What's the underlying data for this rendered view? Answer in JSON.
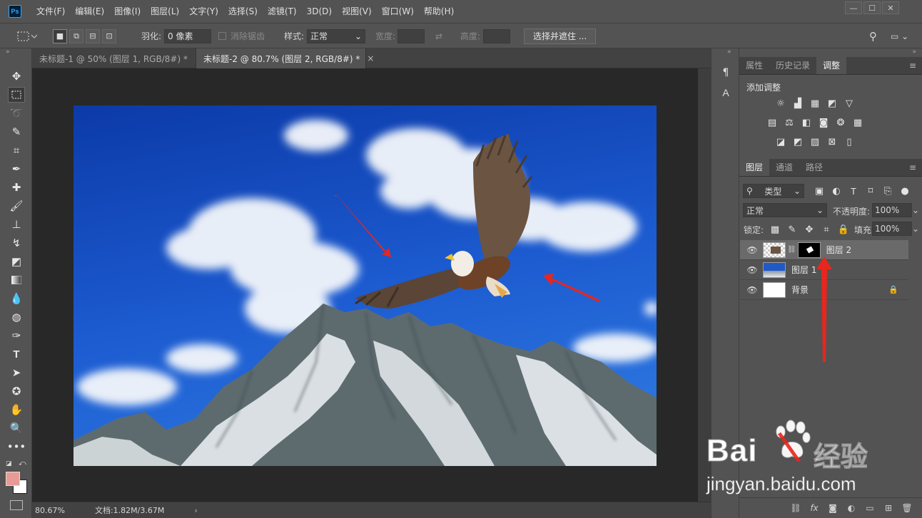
{
  "app": {
    "logo_text": "Ps"
  },
  "menubar": {
    "items": [
      "文件(F)",
      "编辑(E)",
      "图像(I)",
      "图层(L)",
      "文字(Y)",
      "选择(S)",
      "滤镜(T)",
      "3D(D)",
      "视图(V)",
      "窗口(W)",
      "帮助(H)"
    ],
    "window_controls": [
      "minimize",
      "restore",
      "close"
    ]
  },
  "options": {
    "feather_label": "羽化:",
    "feather_value": "0 像素",
    "antialias_label": "消除锯齿",
    "style_label": "样式:",
    "style_value": "正常",
    "width_label": "宽度:",
    "height_label": "高度:",
    "select_mask_button": "选择并遮住 ..."
  },
  "tabs": [
    {
      "label": "未标题-1 @ 50% (图层 1, RGB/8#) *",
      "active": false
    },
    {
      "label": "未标题-2 @ 80.7% (图层 2, RGB/8#) *",
      "active": true
    }
  ],
  "status": {
    "zoom": "80.67%",
    "doc_info": "文档:1.82M/3.67M"
  },
  "panels": {
    "top_tabs": [
      "属性",
      "历史记录",
      "调整"
    ],
    "top_active": 2,
    "adjustments_title": "添加调整",
    "layer_tabs": [
      "图层",
      "通道",
      "路径"
    ],
    "layer_active": 0,
    "filter_kind": "类型",
    "blend_mode": "正常",
    "opacity_label": "不透明度:",
    "opacity_value": "100%",
    "lock_label": "锁定:",
    "fill_label": "填充:",
    "fill_value": "100%"
  },
  "layers": [
    {
      "name": "图层 2",
      "selected": true,
      "has_mask": true
    },
    {
      "name": "图层 1",
      "selected": false
    },
    {
      "name": "背景",
      "selected": false,
      "locked": true
    }
  ],
  "watermark": {
    "brand": "Bai",
    "brand_cn": "经验",
    "url": "jingyan.baidu.com"
  },
  "colors": {
    "foreground": "#e89b95",
    "background": "#ffffff",
    "accent": "#31a8ff",
    "arrow": "#e8261d"
  }
}
